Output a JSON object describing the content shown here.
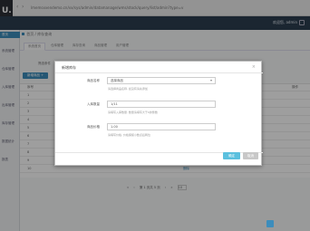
{
  "browser": {
    "logo": "U.",
    "url": "lmemsxvendemo.cn/vx/sys/admin/datamanage/wms/stock/query/list/admin?type=v"
  },
  "app": {
    "user": "欢迎您, admin"
  },
  "sidebar": {
    "items": [
      {
        "label": "首页"
      },
      {
        "label": "系统管理"
      },
      {
        "label": "仓库管理"
      },
      {
        "label": "入库管理"
      },
      {
        "label": "出库管理"
      },
      {
        "label": "库存管理"
      },
      {
        "label": "数据统计"
      },
      {
        "label": "报表"
      }
    ]
  },
  "breadcrumb": {
    "home": "首页",
    "current": "库存查询"
  },
  "tabs": [
    {
      "label": "系统首页"
    },
    {
      "label": "仓库管理"
    },
    {
      "label": "库存查询"
    },
    {
      "label": "商品管理"
    },
    {
      "label": "用户管理"
    }
  ],
  "filter": {
    "label": "筛选条件"
  },
  "toolbar": {
    "add": "新增商品 +"
  },
  "table": {
    "headers": [
      "序号",
      "名称",
      "操作"
    ],
    "rows": [
      {
        "no": "1",
        "name": "",
        "op": ""
      },
      {
        "no": "2",
        "name": "",
        "op": ""
      },
      {
        "no": "3",
        "name": "",
        "op": ""
      },
      {
        "no": "4",
        "name": "",
        "op": ""
      },
      {
        "no": "5",
        "name": "",
        "op": ""
      },
      {
        "no": "6",
        "name": "",
        "op": ""
      },
      {
        "no": "7",
        "name": "",
        "op": ""
      },
      {
        "no": "8",
        "name": "",
        "op": "删除"
      },
      {
        "no": "9",
        "name": "B",
        "op": "删除"
      },
      {
        "no": "10",
        "name": "",
        "op": "删除"
      }
    ]
  },
  "pager": {
    "first": "«",
    "prev": "‹",
    "page_text": "第 1 页共 5 页",
    "next": "›",
    "last": "»",
    "page_size": "10"
  },
  "modal": {
    "title": "新增库存",
    "close": "×",
    "fields": [
      {
        "label": "商品名称",
        "value": "选择商品",
        "help": "请选择商品名称, 如没有请先添加"
      },
      {
        "label": "入库数量",
        "value": "1/11",
        "help": "请填写入库数量, 数量请填写大于0的整数"
      },
      {
        "label": "商品价格",
        "value": "1.00",
        "help": "请填写价格, 价格保留小数点后两位"
      }
    ],
    "ok": "确定",
    "cancel": "取消"
  }
}
